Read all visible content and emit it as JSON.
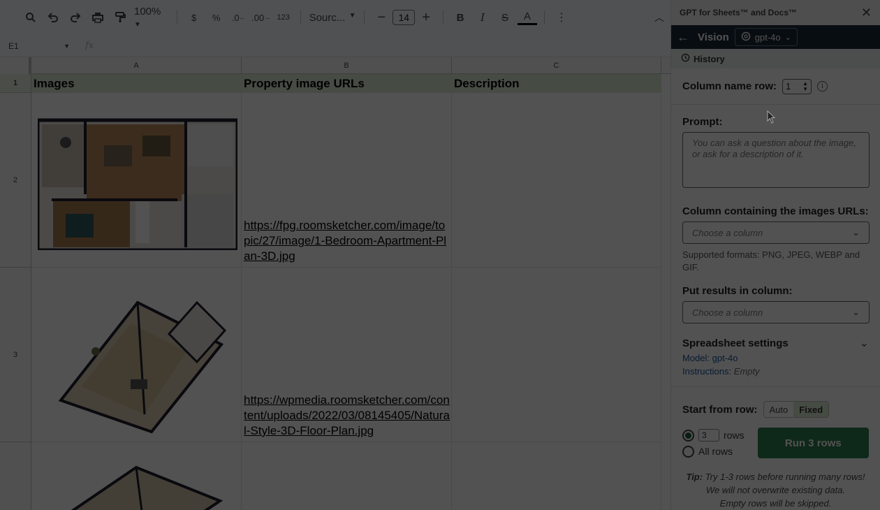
{
  "toolbar": {
    "zoom": "100%",
    "currency": "$",
    "percent": "%",
    "dec_decrease": ".0",
    "dec_increase": ".00",
    "number_format": "123",
    "font": "Sourc...",
    "font_size": "14",
    "bold": "B",
    "italic": "I",
    "strike": "S",
    "text_color": "A"
  },
  "formula_bar": {
    "name_box": "E1",
    "fx": "fx"
  },
  "columns": [
    "A",
    "B",
    "C"
  ],
  "rows": [
    "1",
    "2",
    "3"
  ],
  "sheet": {
    "headers": [
      "Images",
      "Property image URLs",
      "Description"
    ],
    "urls": [
      "https://fpg.roomsketcher.com/image/topic/27/image/1-Bedroom-Apartment-Plan-3D.jpg",
      "https://wpmedia.roomsketcher.com/content/uploads/2022/03/08145405/Natural-Style-3D-Floor-Plan.jpg"
    ]
  },
  "sidebar": {
    "title": "GPT for Sheets™ and Docs™",
    "nav_title": "Vision",
    "model": "gpt-4o",
    "history": "History",
    "column_name_row_label": "Column name row:",
    "column_name_row_value": "1",
    "prompt_label": "Prompt:",
    "prompt_placeholder": "You can ask a question about the image, or ask for a description of it.",
    "images_col_label": "Column containing the images URLs:",
    "images_col_placeholder": "Choose a column",
    "formats_help": "Supported formats: PNG, JPEG, WEBP and GIF.",
    "results_col_label": "Put results in column:",
    "results_col_placeholder": "Choose a column",
    "settings_title": "Spreadsheet settings",
    "model_key": "Model:",
    "model_value": "gpt-4o",
    "instructions_key": "Instructions:",
    "instructions_value": "Empty",
    "start_row_label": "Start from row:",
    "auto": "Auto",
    "fixed": "Fixed",
    "rows_count": "3",
    "rows_label": "rows",
    "all_rows": "All rows",
    "run_button": "Run 3 rows",
    "tip_label": "Tip:",
    "tip_line1": "Try 1-3 rows before running many rows!",
    "tip_line2": "We will not overwrite existing data.",
    "tip_line3": "Empty rows will be skipped."
  }
}
